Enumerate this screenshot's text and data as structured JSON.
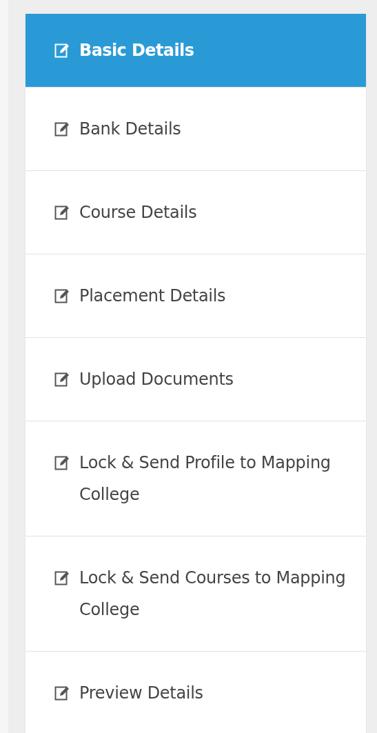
{
  "menu": [
    {
      "label": "Basic Details",
      "selected": true
    },
    {
      "label": "Bank Details",
      "selected": false
    },
    {
      "label": "Course Details",
      "selected": false
    },
    {
      "label": "Placement Details",
      "selected": false
    },
    {
      "label": "Upload Documents",
      "selected": false
    },
    {
      "label": "Lock & Send Profile to Mapping College",
      "selected": false
    },
    {
      "label": "Lock & Send Courses to Mapping College",
      "selected": false
    },
    {
      "label": "Preview Details",
      "selected": false
    }
  ]
}
